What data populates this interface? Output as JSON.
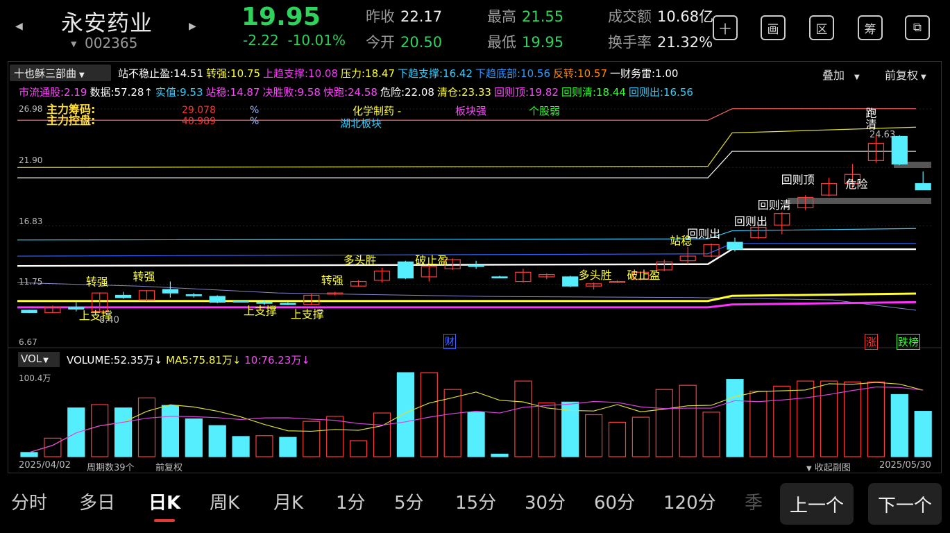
{
  "header": {
    "name": "永安药业",
    "code": "002365",
    "price": "19.95",
    "change": "-2.22",
    "change_pct": "-10.01%",
    "stats": {
      "prev_close_label": "昨收",
      "prev_close": "22.17",
      "open_label": "今开",
      "open": "20.50",
      "high_label": "最高",
      "high": "21.55",
      "low_label": "最低",
      "low": "19.95",
      "turnover_label": "成交额",
      "turnover": "10.68亿",
      "rate_label": "换手率",
      "rate": "21.32%"
    },
    "tools": [
      "十",
      "画",
      "区",
      "筹",
      "⧉"
    ]
  },
  "indicator": {
    "name": "十也稣三部曲",
    "line1": [
      {
        "k": "站不稳止盈:",
        "v": "14.51",
        "c": "#ffffff"
      },
      {
        "k": "转强:",
        "v": "10.75",
        "c": "#ffff33"
      },
      {
        "k": "上趋支撑:",
        "v": "10.08",
        "c": "#ff33ff"
      },
      {
        "k": "压力:",
        "v": "18.47",
        "c": "#ffff33"
      },
      {
        "k": "下趋支撑:",
        "v": "16.42",
        "c": "#33ccff"
      },
      {
        "k": "下趋底部:",
        "v": "10.56",
        "c": "#3399ff"
      },
      {
        "k": "反转:",
        "v": "10.57",
        "c": "#ff8800"
      },
      {
        "k": "一财务雷:",
        "v": "1.00",
        "c": "#ffffff"
      }
    ],
    "line2": [
      {
        "k": "市流通股:",
        "v": "2.19",
        "c": "#ff44ff"
      },
      {
        "k": "数据:",
        "v": "57.28↑",
        "c": "#ffffff"
      },
      {
        "k": "实值:",
        "v": "9.53",
        "c": "#33ccff"
      },
      {
        "k": "站稳:",
        "v": "14.87",
        "c": "#ff44ff"
      },
      {
        "k": "决胜败:",
        "v": "9.58",
        "c": "#ff44ff"
      },
      {
        "k": "快跑:",
        "v": "24.58",
        "c": "#ff44ff"
      },
      {
        "k": "危险:",
        "v": "22.08",
        "c": "#ffffff"
      },
      {
        "k": "清仓:",
        "v": "23.33",
        "c": "#ffff33"
      },
      {
        "k": "回则顶:",
        "v": "19.82",
        "c": "#ff44ff"
      },
      {
        "k": "回则清:",
        "v": "18.44",
        "c": "#33ff33"
      },
      {
        "k": "回则出:",
        "v": "16.56",
        "c": "#33ccff"
      }
    ],
    "overlay_label": "叠加",
    "adjust_label": "前复权"
  },
  "chart": {
    "y_ticks": [
      "26.98",
      "21.90",
      "16.83",
      "11.75",
      "6.67"
    ],
    "info": {
      "chip_label": "主力筹码:",
      "chip_value": "29.078",
      "chip_unit": "%",
      "control_label": "主力控盘:",
      "control_value": "40.989",
      "control_unit": "%",
      "sector": "化学制药 -",
      "region": "湖北板块",
      "sector_strength": "板块强",
      "stock_strength": "个股弱"
    },
    "low_label": "8.40",
    "high_label": "24.63",
    "finance_tag": "财",
    "rise_tag": "涨",
    "fall_tag": "跌榜",
    "signals": [
      "转强",
      "转强",
      "上支撑",
      "上支撑",
      "上支撑",
      "转强",
      "多头胜",
      "破止盈",
      "多头胜",
      "破止盈",
      "站稳",
      "回则出",
      "回则出",
      "回则清",
      "回则顶",
      "危险",
      "跑",
      "清"
    ]
  },
  "volume": {
    "label": "VOL",
    "volume": "VOLUME:52.35万↓",
    "ma5": "MA5:75.81万↓",
    "ma10": "10:76.23万↓",
    "max_tick": "100.4万"
  },
  "footer": {
    "start_date": "2025/04/02",
    "period_count": "周期数39个",
    "adjust": "前复权",
    "collapse": "收起副图",
    "end_date": "2025/05/30"
  },
  "tabs": [
    "分时",
    "多日",
    "日K",
    "周K",
    "月K",
    "1分",
    "5分",
    "15分",
    "30分",
    "60分",
    "120分",
    "季"
  ],
  "active_tab": "日K",
  "nav": {
    "prev": "上一个",
    "next": "下一个"
  },
  "candles": [
    {
      "o": 9.3,
      "c": 9.5,
      "h": 9.55,
      "l": 9.25,
      "up": false
    },
    {
      "o": 9.3,
      "c": 9.8,
      "h": 9.9,
      "l": 9.25,
      "up": true
    },
    {
      "o": 9.6,
      "c": 9.75,
      "h": 10.2,
      "l": 9.4,
      "up": false
    },
    {
      "o": 9.4,
      "c": 11.0,
      "h": 11.05,
      "l": 9.35,
      "up": true
    },
    {
      "o": 10.6,
      "c": 10.8,
      "h": 11.1,
      "l": 10.5,
      "up": false
    },
    {
      "o": 10.4,
      "c": 11.2,
      "h": 11.25,
      "l": 10.3,
      "up": true
    },
    {
      "o": 11.0,
      "c": 11.3,
      "h": 12.0,
      "l": 10.6,
      "up": false
    },
    {
      "o": 10.8,
      "c": 10.85,
      "h": 11.0,
      "l": 10.6,
      "up": false
    },
    {
      "o": 10.7,
      "c": 10.2,
      "h": 10.8,
      "l": 10.1,
      "up": false
    },
    {
      "o": 10.3,
      "c": 10.3,
      "h": 10.4,
      "l": 10.2,
      "up": false
    },
    {
      "o": 10.2,
      "c": 10.1,
      "h": 10.4,
      "l": 9.95,
      "up": false
    },
    {
      "o": 10.0,
      "c": 10.1,
      "h": 10.2,
      "l": 9.95,
      "up": false
    },
    {
      "o": 10.0,
      "c": 10.8,
      "h": 10.9,
      "l": 9.95,
      "up": true
    },
    {
      "o": 10.9,
      "c": 11.0,
      "h": 11.1,
      "l": 10.8,
      "up": true
    },
    {
      "o": 11.6,
      "c": 12.0,
      "h": 12.1,
      "l": 11.55,
      "up": true
    },
    {
      "o": 12.1,
      "c": 12.9,
      "h": 13.2,
      "l": 11.9,
      "up": true
    },
    {
      "o": 13.7,
      "c": 12.3,
      "h": 13.8,
      "l": 12.2,
      "up": false
    },
    {
      "o": 12.4,
      "c": 13.3,
      "h": 13.4,
      "l": 12.0,
      "up": true
    },
    {
      "o": 13.1,
      "c": 13.9,
      "h": 14.0,
      "l": 13.0,
      "up": true
    },
    {
      "o": 13.4,
      "c": 13.3,
      "h": 13.8,
      "l": 13.1,
      "up": false
    },
    {
      "o": 12.4,
      "c": 12.4,
      "h": 12.5,
      "l": 12.3,
      "up": false
    },
    {
      "o": 12.0,
      "c": 12.8,
      "h": 13.1,
      "l": 11.9,
      "up": true
    },
    {
      "o": 12.4,
      "c": 12.6,
      "h": 12.7,
      "l": 12.2,
      "up": true
    },
    {
      "o": 12.4,
      "c": 11.6,
      "h": 12.5,
      "l": 11.5,
      "up": false
    },
    {
      "o": 11.6,
      "c": 11.8,
      "h": 11.9,
      "l": 11.3,
      "up": true
    },
    {
      "o": 11.9,
      "c": 12.0,
      "h": 12.1,
      "l": 11.9,
      "up": true
    },
    {
      "o": 12.2,
      "c": 12.8,
      "h": 12.9,
      "l": 12.1,
      "up": true
    },
    {
      "o": 13.0,
      "c": 13.7,
      "h": 13.9,
      "l": 12.9,
      "up": true
    },
    {
      "o": 13.8,
      "c": 14.2,
      "h": 15.0,
      "l": 13.5,
      "up": true
    },
    {
      "o": 14.2,
      "c": 15.2,
      "h": 15.3,
      "l": 14.1,
      "up": true
    },
    {
      "o": 14.8,
      "c": 15.4,
      "h": 15.8,
      "l": 14.6,
      "up": false
    },
    {
      "o": 15.8,
      "c": 16.7,
      "h": 16.9,
      "l": 15.7,
      "up": true
    },
    {
      "o": 16.9,
      "c": 17.9,
      "h": 18.0,
      "l": 16.1,
      "up": true
    },
    {
      "o": 18.4,
      "c": 19.3,
      "h": 19.5,
      "l": 18.2,
      "up": true
    },
    {
      "o": 19.5,
      "c": 20.5,
      "h": 21.0,
      "l": 19.4,
      "up": true
    },
    {
      "o": 20.5,
      "c": 21.3,
      "h": 22.2,
      "l": 20.1,
      "up": true
    },
    {
      "o": 24.0,
      "c": 22.5,
      "h": 24.63,
      "l": 22.3,
      "up": true
    },
    {
      "o": 24.6,
      "c": 22.2,
      "h": 24.7,
      "l": 22.1,
      "up": false
    },
    {
      "o": 20.5,
      "c": 19.95,
      "h": 21.55,
      "l": 19.95,
      "up": false
    }
  ],
  "volumes": [
    {
      "v": 0.05,
      "up": false
    },
    {
      "v": 0.22,
      "up": true
    },
    {
      "v": 0.58,
      "up": false
    },
    {
      "v": 0.62,
      "up": true
    },
    {
      "v": 0.58,
      "up": false
    },
    {
      "v": 0.7,
      "up": true
    },
    {
      "v": 0.61,
      "up": false
    },
    {
      "v": 0.45,
      "up": false
    },
    {
      "v": 0.37,
      "up": false
    },
    {
      "v": 0.24,
      "up": false
    },
    {
      "v": 0.25,
      "up": true
    },
    {
      "v": 0.23,
      "up": false
    },
    {
      "v": 0.42,
      "up": true
    },
    {
      "v": 0.48,
      "up": true
    },
    {
      "v": 0.19,
      "up": true
    },
    {
      "v": 0.52,
      "up": true
    },
    {
      "v": 1.0,
      "up": false
    },
    {
      "v": 1.0,
      "up": true
    },
    {
      "v": 0.8,
      "up": true
    },
    {
      "v": 0.53,
      "up": false
    },
    {
      "v": 0.03,
      "up": false
    },
    {
      "v": 0.9,
      "up": true
    },
    {
      "v": 0.64,
      "up": true
    },
    {
      "v": 0.65,
      "up": false
    },
    {
      "v": 0.5,
      "up": true
    },
    {
      "v": 0.41,
      "up": true
    },
    {
      "v": 0.47,
      "up": true
    },
    {
      "v": 0.8,
      "up": true
    },
    {
      "v": 0.85,
      "up": true
    },
    {
      "v": 0.53,
      "up": true
    },
    {
      "v": 0.92,
      "up": false
    },
    {
      "v": 0.78,
      "up": true
    },
    {
      "v": 0.84,
      "up": true
    },
    {
      "v": 0.9,
      "up": true
    },
    {
      "v": 0.9,
      "up": true
    },
    {
      "v": 0.89,
      "up": true
    },
    {
      "v": 0.89,
      "up": true
    },
    {
      "v": 0.74,
      "up": false
    },
    {
      "v": 0.54,
      "up": false
    }
  ]
}
